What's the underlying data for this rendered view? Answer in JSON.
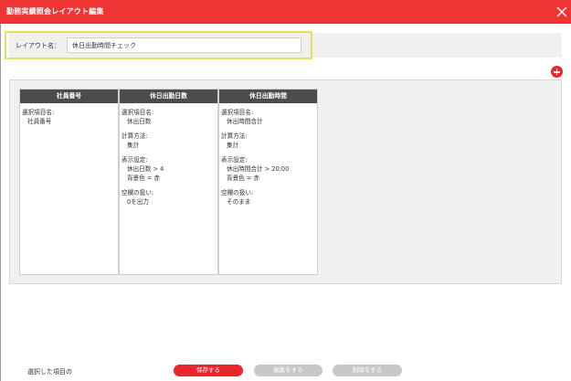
{
  "window": {
    "title": "勤務実績照会レイアウト編集",
    "accent_color": "#ee3534"
  },
  "layout_name": {
    "label": "レイアウト名：",
    "value": "休日出勤時間チェック"
  },
  "columns": [
    {
      "header": "社員番号",
      "item_name_label": "選択項目名:",
      "item_name_value": "社員番号"
    },
    {
      "header": "休日出勤日数",
      "item_name_label": "選択項目名:",
      "item_name_value": "休出日数",
      "calc_label": "計算方法:",
      "calc_value": "集計",
      "display_label": "表示設定:",
      "display_condition": "休出日数 > 4",
      "display_color": "背景色 = 赤",
      "empty_label": "空欄の扱い:",
      "empty_value": "0を出力"
    },
    {
      "header": "休日出勤時間",
      "item_name_label": "選択項目名:",
      "item_name_value": "休出時間合計",
      "calc_label": "計算方法:",
      "calc_value": "集計",
      "display_label": "表示設定:",
      "display_condition": "休出時間合計 > 20:00",
      "display_color": "背景色 = 赤",
      "empty_label": "空欄の扱い:",
      "empty_value": "そのまま"
    }
  ],
  "footer": {
    "selected_text": "選択した項目の",
    "save_label": "保存する",
    "edit_label": "編集をする",
    "delete_label": "削除をする"
  }
}
